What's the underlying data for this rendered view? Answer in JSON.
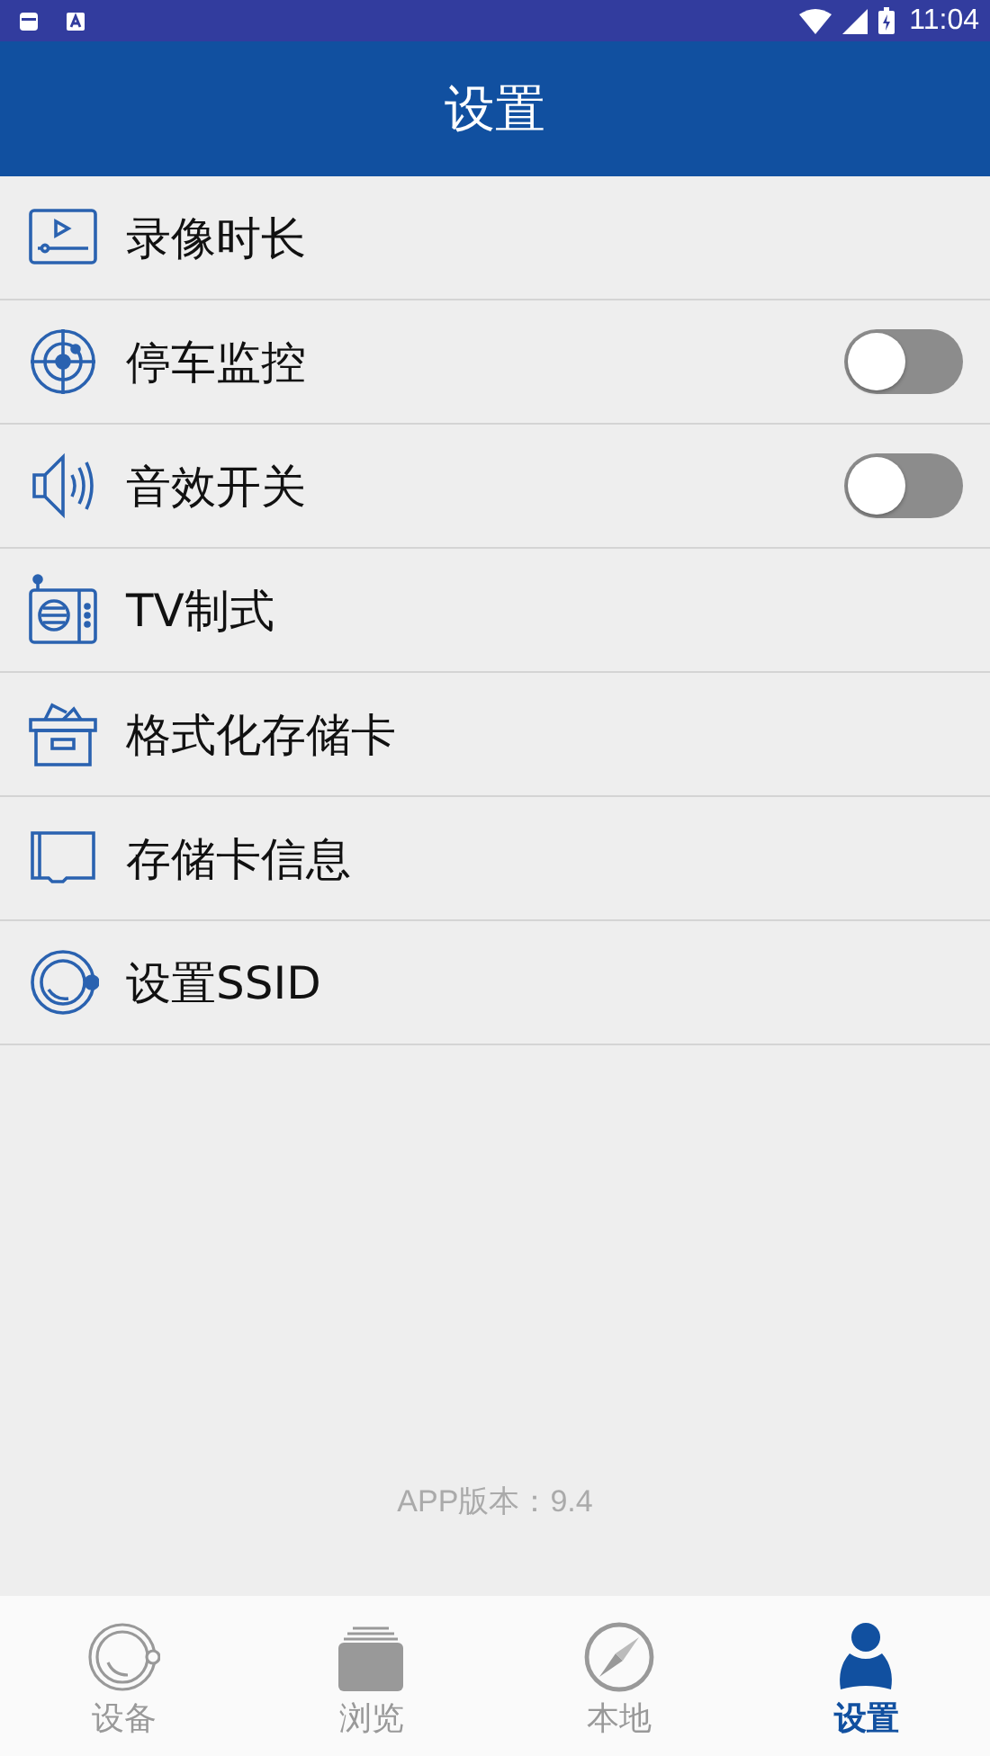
{
  "status_bar": {
    "time": "11:04"
  },
  "header": {
    "title": "设置"
  },
  "settings": [
    {
      "label": "录像时长",
      "kind": "link"
    },
    {
      "label": "停车监控",
      "kind": "toggle",
      "on": false
    },
    {
      "label": "音效开关",
      "kind": "toggle",
      "on": false
    },
    {
      "label": "TV制式",
      "kind": "link"
    },
    {
      "label": "格式化存储卡",
      "kind": "link"
    },
    {
      "label": "存储卡信息",
      "kind": "link"
    },
    {
      "label": "设置SSID",
      "kind": "link"
    }
  ],
  "version": "APP版本：9.4",
  "tabs": [
    {
      "label": "设备",
      "selected": false
    },
    {
      "label": "浏览",
      "selected": false
    },
    {
      "label": "本地",
      "selected": false
    },
    {
      "label": "设置",
      "selected": true
    }
  ]
}
